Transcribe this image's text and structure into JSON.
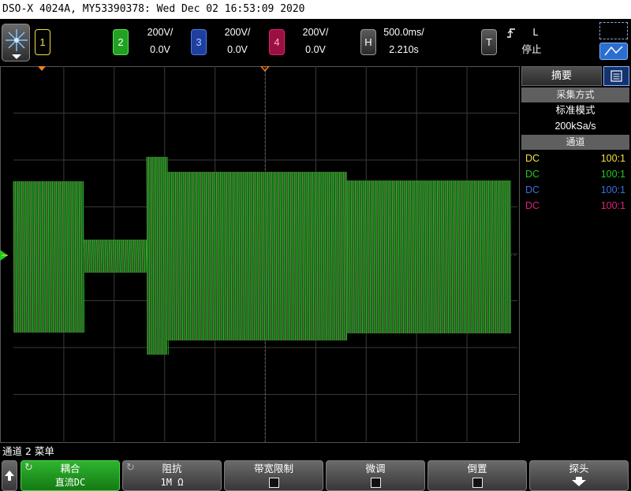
{
  "title": "DSO-X 4024A, MY53390378: Wed Dec 02 16:53:09 2020",
  "channels": [
    {
      "num": "1",
      "color": "#f0e040"
    },
    {
      "num": "2",
      "color": "#22c822",
      "scale": "200V/",
      "offset": "0.0V"
    },
    {
      "num": "3",
      "color": "#3a6fe0",
      "scale": "200V/",
      "offset": "0.0V"
    },
    {
      "num": "4",
      "color": "#e0207a",
      "scale": "200V/",
      "offset": "0.0V"
    }
  ],
  "horizontal": {
    "label": "H",
    "scale": "500.0ms/",
    "delay": "2.210s"
  },
  "trigger": {
    "label": "T",
    "slope_icon": "rising-edge-icon",
    "mode": "L",
    "status": "停止"
  },
  "panel": {
    "tab_label": "摘要",
    "acq_header": "采集方式",
    "acq_mode": "标准模式",
    "sample_rate": "200kSa/s",
    "channels_header": "通道",
    "channel_rows": [
      {
        "coupling": "DC",
        "probe": "100:1",
        "color": "#f0e040"
      },
      {
        "coupling": "DC",
        "probe": "100:1",
        "color": "#22c822"
      },
      {
        "coupling": "DC",
        "probe": "100:1",
        "color": "#3a6fe0"
      },
      {
        "coupling": "DC",
        "probe": "100:1",
        "color": "#e0207a"
      }
    ]
  },
  "menu": {
    "title": "通道 2 菜单",
    "softkeys": [
      {
        "label": "耦合",
        "value": "直流DC"
      },
      {
        "label": "阻抗",
        "value": "1M Ω"
      },
      {
        "label": "带宽限制"
      },
      {
        "label": "微调"
      },
      {
        "label": "倒置"
      },
      {
        "label": "探头"
      }
    ]
  },
  "waveform": {
    "description_colors": {
      "ch2": "#22c822",
      "ch4": "#e0207a"
    }
  }
}
